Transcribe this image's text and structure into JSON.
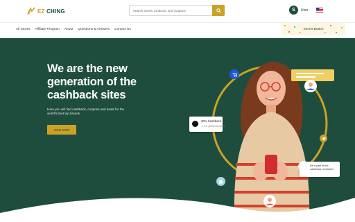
{
  "header": {
    "logo_ez": "EZ",
    "logo_ching": "CHING",
    "search_placeholder": "Search stores, products, and coupons",
    "user_initial": "S",
    "user_label": "User"
  },
  "nav": {
    "links": [
      "All Stores",
      "Affiliate Program",
      "About",
      "Questions & Answers",
      "Contact Us"
    ],
    "secret_button": "Secret Button"
  },
  "hero": {
    "headline": [
      "We are the new",
      "generation of the",
      "cashback sites"
    ],
    "subcopy": "Here you will find cashback, coupons and deals for the world's best top brands",
    "join_button": "JOIN NOW",
    "cashback_card": {
      "title": "30% Cashback",
      "rating": "4.5",
      "reviews": "(1000 Reviews)"
    },
    "message_card": "Be a part of the cashback revolution"
  },
  "colors": {
    "brand_green": "#1f4d3d",
    "brand_gold": "#c9a227",
    "accent_blue": "#1d5ad6"
  },
  "icons": {
    "search": "search-icon",
    "cart": "shopping-cart-icon",
    "bag": "shopping-bag-icon",
    "tag": "price-tag-icon",
    "flag": "us-flag-icon"
  }
}
